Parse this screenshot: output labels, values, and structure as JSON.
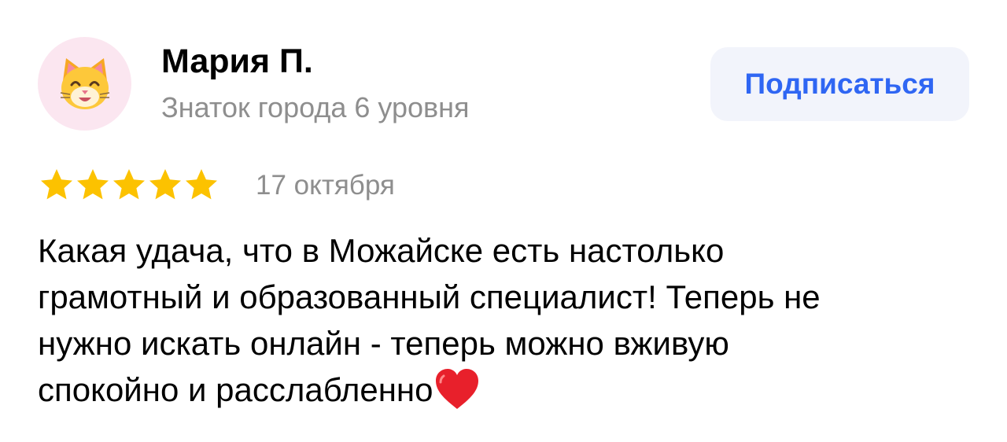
{
  "author": {
    "avatar_icon": "cat-face-icon",
    "name": "Мария П.",
    "level": "Знаток города 6 уровня"
  },
  "subscribe_button": {
    "label": "Подписаться",
    "color": "#2f66f3",
    "background": "#f2f4fb"
  },
  "rating": {
    "stars": 5,
    "max_stars": 5,
    "star_color": "#fcc200",
    "date": "17 октября"
  },
  "review": {
    "lines": [
      "Какая удача, что в Можайске есть настолько",
      "грамотный и образованный специалист! Теперь не",
      "нужно искать онлайн - теперь можно вживую",
      "спокойно и расслабленно"
    ],
    "trailing_icon": "red-heart-icon"
  }
}
